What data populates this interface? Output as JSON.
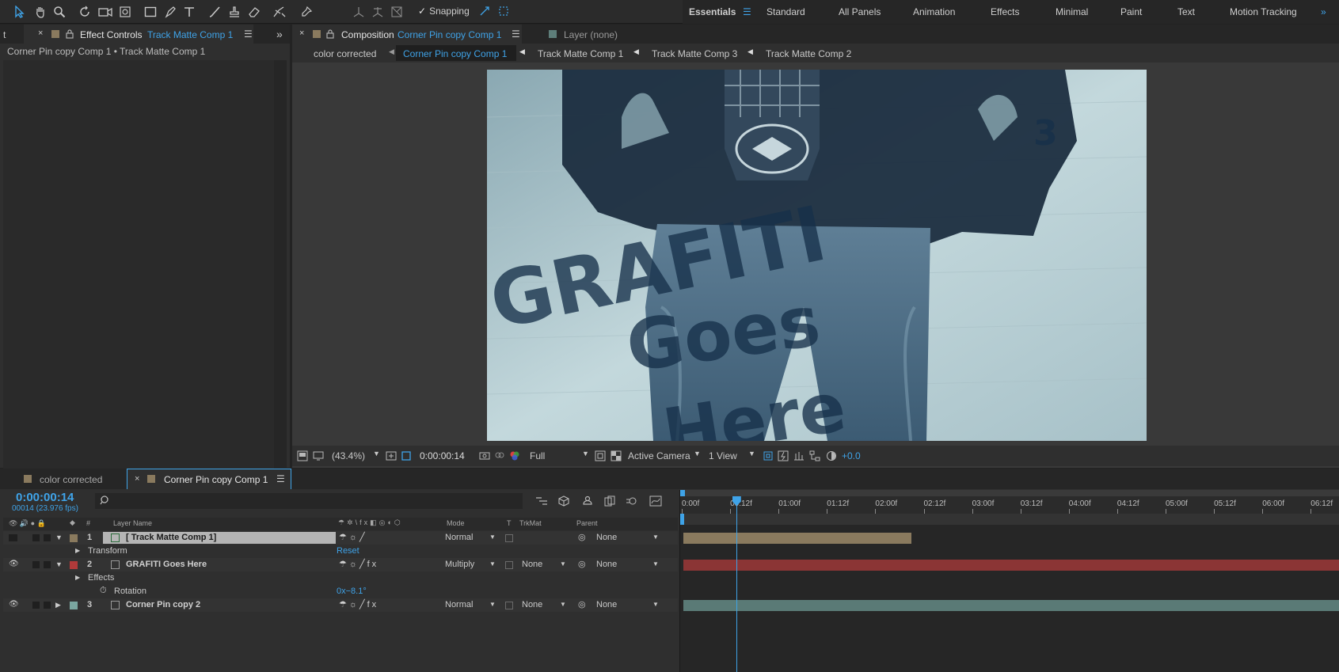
{
  "toolbar": {
    "snapping_label": "Snapping",
    "workspaces": [
      "Essentials",
      "Standard",
      "All Panels",
      "Animation",
      "Effects",
      "Minimal",
      "Paint",
      "Text",
      "Motion Tracking"
    ],
    "active_workspace": "Essentials"
  },
  "effect_controls": {
    "stub_tab": "t",
    "tab_prefix": "Effect Controls",
    "tab_target": "Track Matte Comp 1",
    "breadcrumb": "Corner Pin copy  Comp 1 • Track Matte Comp 1"
  },
  "composition": {
    "tab_prefix": "Composition",
    "tab_target": "Corner Pin copy  Comp 1",
    "layer_tab": "Layer (none)",
    "flow": [
      "color corrected",
      "Corner Pin copy  Comp 1",
      "Track Matte Comp 1",
      "Track Matte Comp 3",
      "Track Matte Comp 2"
    ],
    "active_flow_index": 1,
    "viewer_text": {
      "line1": "GRAFITI",
      "line2": "Goes",
      "line3": "Here",
      "corner_number": "3"
    },
    "footer": {
      "zoom": "(43.4%)",
      "timecode": "0:00:00:14",
      "resolution": "Full",
      "camera": "Active Camera",
      "views": "1 View",
      "exposure": "+0.0"
    }
  },
  "timeline": {
    "tabs": [
      "color corrected",
      "Corner Pin copy  Comp 1"
    ],
    "active_tab_index": 1,
    "current_time": "0:00:00:14",
    "frame_info": "00014 (23.976 fps)",
    "columns": {
      "number": "#",
      "layer_name": "Layer Name",
      "mode": "Mode",
      "t": "T",
      "trkmat": "TrkMat",
      "parent": "Parent"
    },
    "ruler": [
      "0:00f",
      "00:12f",
      "01:00f",
      "01:12f",
      "02:00f",
      "02:12f",
      "03:00f",
      "03:12f",
      "04:00f",
      "04:12f",
      "05:00f",
      "05:12f",
      "06:00f",
      "06:12f"
    ],
    "playhead_fraction": 0.085,
    "rows": [
      {
        "kind": "layer",
        "num": "1",
        "name": "[ Track Matte Comp 1]",
        "mode": "Normal",
        "trkmat": "",
        "parent": "None",
        "label_color": "#8a7a5e",
        "expanded": true,
        "selected": true
      },
      {
        "kind": "group",
        "name": "Transform",
        "value": "Reset"
      },
      {
        "kind": "layer",
        "num": "2",
        "name": "GRAFITI Goes Here",
        "mode": "Multiply",
        "trkmat": "None",
        "parent": "None",
        "label_color": "#b03a3a",
        "expanded": true,
        "selected": false
      },
      {
        "kind": "group",
        "name": "Effects",
        "value": ""
      },
      {
        "kind": "prop",
        "name": "Rotation",
        "value": "0x−8.1°"
      },
      {
        "kind": "layer",
        "num": "3",
        "name": "Corner Pin copy  2",
        "mode": "Normal",
        "trkmat": "None",
        "parent": "None",
        "label_color": "#7aa6a0",
        "expanded": false,
        "selected": false
      }
    ],
    "bars": [
      {
        "row": 0,
        "color": "#8a7a5e",
        "start": 0.0,
        "end": 0.35
      },
      {
        "row": 2,
        "color": "#8b3535",
        "start": 0.0,
        "end": 1.0
      },
      {
        "row": 5,
        "color": "#5a7a76",
        "start": 0.0,
        "end": 1.0
      }
    ]
  }
}
